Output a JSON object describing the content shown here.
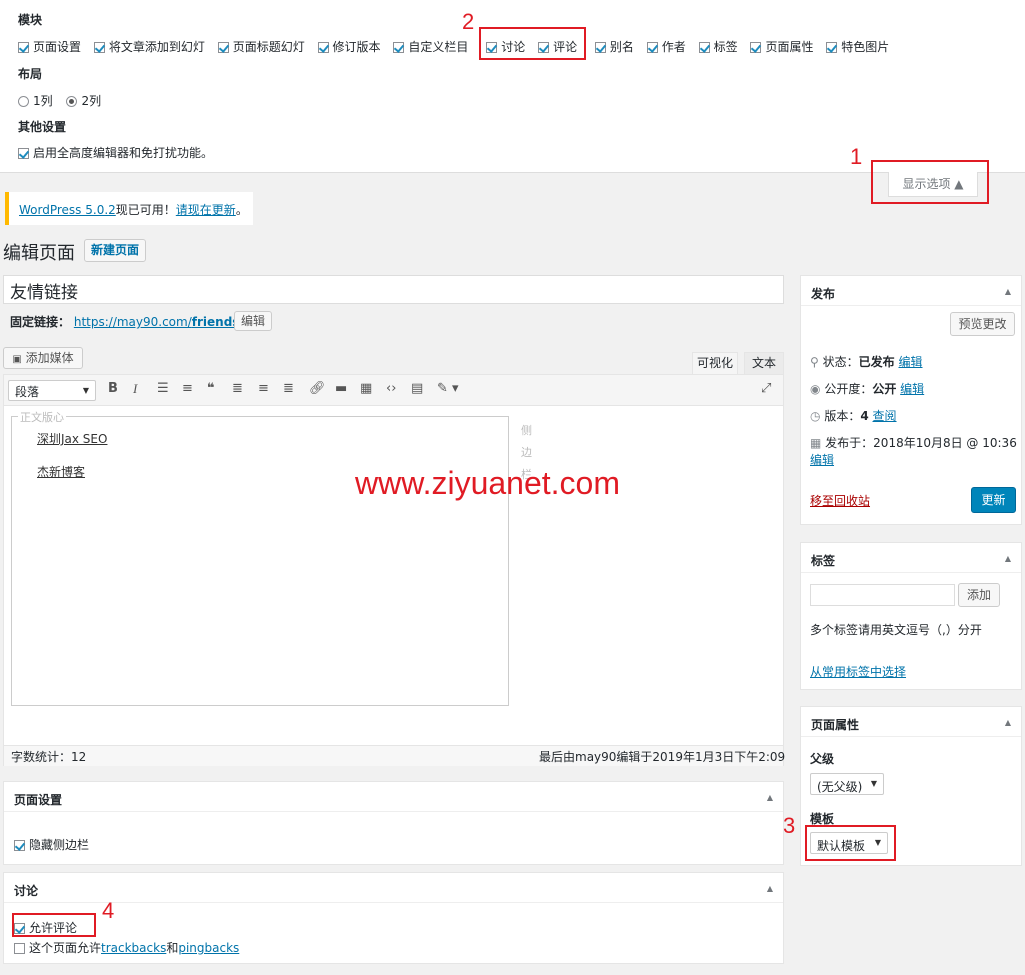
{
  "screen_options": {
    "modules_title": "模块",
    "modules": [
      "页面设置",
      "将文章添加到幻灯",
      "页面标题幻灯",
      "修订版本",
      "自定义栏目",
      "讨论",
      "评论",
      "别名",
      "作者",
      "标签",
      "页面属性",
      "特色图片"
    ],
    "layout_title": "布局",
    "layout_options": [
      "1列",
      "2列"
    ],
    "other_title": "其他设置",
    "other_option": "启用全高度编辑器和免打扰功能。",
    "toggle_label": "显示选项 ▲"
  },
  "notice": {
    "link1": "WordPress 5.0.2",
    "text": "现已可用！",
    "link2": "请现在更新",
    "end": "。"
  },
  "page": {
    "title": "编辑页面",
    "new_button": "新建页面"
  },
  "editor": {
    "post_title": "友情链接",
    "permalink_label": "固定链接：",
    "permalink_base": "https://may90.com/",
    "permalink_slug": "friends",
    "permalink_edit": "编辑",
    "add_media": "添加媒体",
    "tab_visual": "可视化",
    "tab_text": "文本",
    "format_select": "段落",
    "fieldset_legend": "正文版心",
    "links": [
      "深圳Jax SEO",
      "杰新博客"
    ],
    "sidebar_label": [
      "侧",
      "边",
      "栏"
    ],
    "word_count": "字数统计：12",
    "last_edit": "最后由may90编辑于2019年1月3日下午2:09"
  },
  "watermark": "www.ziyuanet.com",
  "annotations": [
    "1",
    "2",
    "3",
    "4"
  ],
  "publish": {
    "title": "发布",
    "preview": "预览更改",
    "status_label": "状态：",
    "status_value": "已发布",
    "visibility_label": "公开度：",
    "visibility_value": "公开",
    "revisions_label": "版本：",
    "revisions_value": "4",
    "browse": "查阅",
    "published_on": "发布于：2018年10月8日 @ 10:36",
    "edit": "编辑",
    "trash": "移至回收站",
    "update": "更新"
  },
  "tags": {
    "title": "标签",
    "add": "添加",
    "hint": "多个标签请用英文逗号（,）分开",
    "choose": "从常用标签中选择"
  },
  "attributes": {
    "title": "页面属性",
    "parent_label": "父级",
    "parent_value": "(无父级)",
    "template_label": "模板",
    "template_value": "默认模板"
  },
  "page_settings": {
    "title": "页面设置",
    "option": "隐藏侧边栏"
  },
  "discussion": {
    "title": "讨论",
    "allow_comments": "允许评论",
    "trackbacks_pre": "这个页面允许",
    "trackbacks_link1": "trackbacks",
    "and": "和",
    "trackbacks_link2": "pingbacks"
  },
  "colors": {
    "accent": "#0085ba",
    "red_annotation": "#e01b24",
    "notice_border": "#ffb900"
  }
}
